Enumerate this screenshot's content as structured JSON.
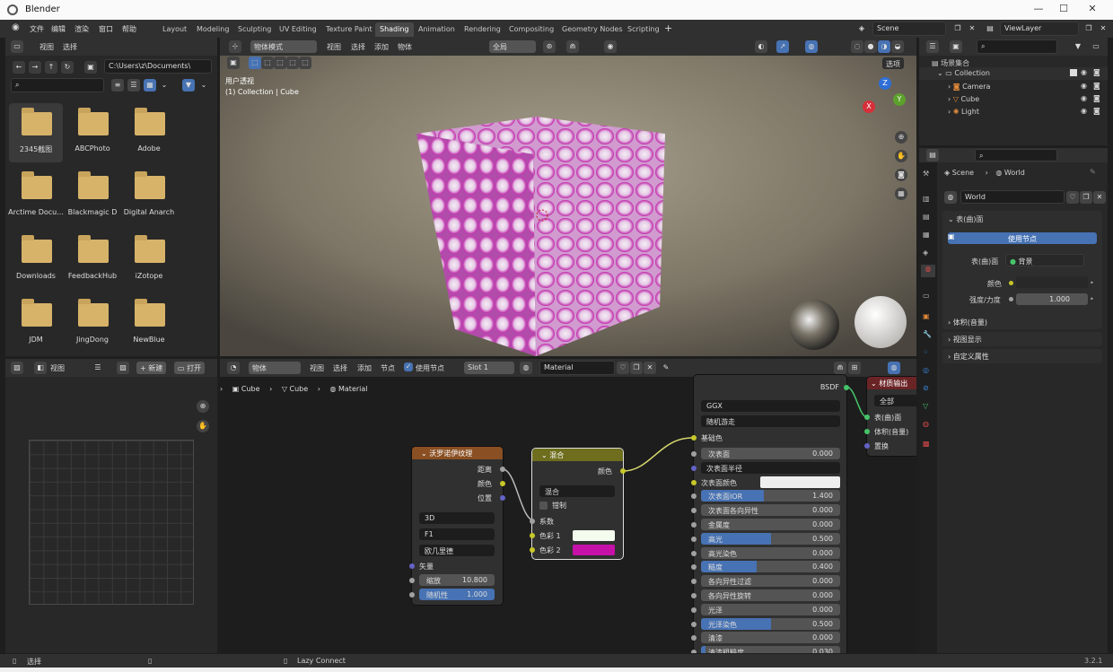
{
  "window": {
    "title": "Blender",
    "version": "3.2.1"
  },
  "menu": {
    "file": "文件",
    "edit": "编辑",
    "render": "渲染",
    "window": "窗口",
    "help": "帮助"
  },
  "workspaces": [
    "Layout",
    "Modeling",
    "Sculpting",
    "UV Editing",
    "Texture Paint",
    "Shading",
    "Animation",
    "Rendering",
    "Compositing",
    "Geometry Nodes",
    "Scripting"
  ],
  "active_workspace": "Shading",
  "scene": {
    "name": "Scene",
    "view_layer": "ViewLayer"
  },
  "file_browser": {
    "menu_view": "视图",
    "menu_select": "选择",
    "path": "C:\\Users\\z\\Documents\\",
    "folders": [
      "2345截图",
      "ABCPhoto",
      "Adobe",
      "Arctime Docu...",
      "Blackmagic D",
      "Digital Anarch",
      "Downloads",
      "FeedbackHub",
      "iZotope",
      "JDM",
      "JingDong",
      "NewBlue"
    ]
  },
  "image_editor": {
    "view": "视图",
    "new": "新建",
    "open": "打开"
  },
  "viewport": {
    "mode": "物体模式",
    "view": "视图",
    "select": "选择",
    "add": "添加",
    "object": "物体",
    "orientation": "全局",
    "options": "选项",
    "overlay_title": "用户透视",
    "overlay_sub": "(1) Collection | Cube",
    "gizmo": {
      "x": "X",
      "y": "Y",
      "z": "Z"
    }
  },
  "node_editor": {
    "object": "物体",
    "view": "视图",
    "select": "选择",
    "add": "添加",
    "node": "节点",
    "use_nodes": "使用节点",
    "slot": "Slot 1",
    "material": "Material",
    "breadcrumb": [
      "Cube",
      "Cube",
      "Material"
    ],
    "voronoi": {
      "title": "沃罗诺伊纹理",
      "out_distance": "距离",
      "out_color": "颜色",
      "out_position": "位置",
      "dim": "3D",
      "feature": "F1",
      "metric": "欧几里德",
      "vector": "矢量",
      "scale_label": "缩放",
      "scale": "10.800",
      "random_label": "随机性",
      "random": "1.000"
    },
    "mix": {
      "title": "混合",
      "out_color": "颜色",
      "blend": "混合",
      "clamp": "钳制",
      "factor": "系数",
      "color1": "色彩 1",
      "color2": "色彩 2",
      "color1_hex": "#f4fbef",
      "color2_hex": "#c511a8"
    },
    "bsdf": {
      "out": "BSDF",
      "distribution": "GGX",
      "subsurface_method": "随机游走",
      "base_color": "基础色",
      "rows": [
        {
          "label": "次表面",
          "value": "0.000",
          "fill": 0
        },
        {
          "label": "次表面半径",
          "value": "",
          "fill": 0,
          "dropdown": true
        },
        {
          "label": "次表面颜色",
          "value": "",
          "fill": 0,
          "swatch": true
        },
        {
          "label": "次表面IOR",
          "value": "1.400",
          "fill": 0.45
        },
        {
          "label": "次表面各向异性",
          "value": "0.000",
          "fill": 0
        },
        {
          "label": "金属度",
          "value": "0.000",
          "fill": 0
        },
        {
          "label": "高光",
          "value": "0.500",
          "fill": 0.5
        },
        {
          "label": "高光染色",
          "value": "0.000",
          "fill": 0
        },
        {
          "label": "糙度",
          "value": "0.400",
          "fill": 0.4
        },
        {
          "label": "各向异性过滤",
          "value": "0.000",
          "fill": 0
        },
        {
          "label": "各向异性旋转",
          "value": "0.000",
          "fill": 0
        },
        {
          "label": "光泽",
          "value": "0.000",
          "fill": 0
        },
        {
          "label": "光泽染色",
          "value": "0.500",
          "fill": 0.5
        },
        {
          "label": "清漆",
          "value": "0.000",
          "fill": 0
        },
        {
          "label": "清漆粗糙度",
          "value": "0.030",
          "fill": 0.03
        }
      ]
    },
    "output": {
      "title": "材质输出",
      "target": "全部",
      "surface": "表(曲)面",
      "volume": "体积(音量)",
      "displacement": "置换"
    }
  },
  "outliner": {
    "root": "场景集合",
    "collection": "Collection",
    "items": [
      "Camera",
      "Cube",
      "Light"
    ]
  },
  "properties": {
    "breadcrumb_scene": "Scene",
    "breadcrumb_world": "World",
    "world_name": "World",
    "surface_panel": "表(曲)面",
    "use_nodes": "使用节点",
    "surface_label": "表(曲)面",
    "surface_value": "背景",
    "color_label": "颜色",
    "strength_label": "强度/力度",
    "strength": "1.000",
    "volume": "体积(音量)",
    "viewport_display": "视图显示",
    "custom_props": "自定义属性"
  },
  "statusbar": {
    "select": "选择",
    "lazy": "Lazy Connect",
    "version": "3.2.1"
  }
}
